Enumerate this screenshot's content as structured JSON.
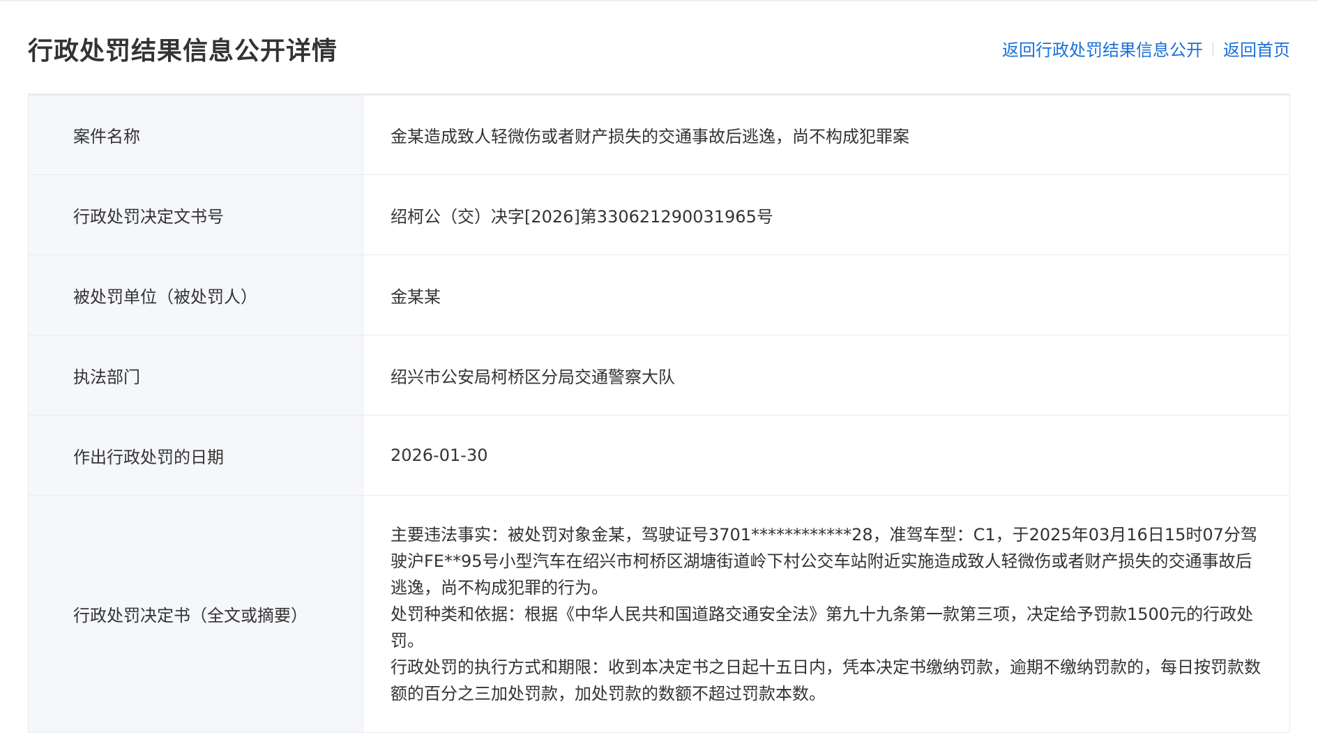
{
  "header": {
    "title": "行政处罚结果信息公开详情",
    "link_back": "返回行政处罚结果信息公开",
    "link_home": "返回首页"
  },
  "rows": [
    {
      "label": "案件名称",
      "value": "金某造成致人轻微伤或者财产损失的交通事故后逃逸，尚不构成犯罪案"
    },
    {
      "label": "行政处罚决定文书号",
      "value": "绍柯公（交）决字[2026]第330621290031965号"
    },
    {
      "label": "被处罚单位（被处罚人）",
      "value": "金某某"
    },
    {
      "label": "执法部门",
      "value": "绍兴市公安局柯桥区分局交通警察大队"
    },
    {
      "label": "作出行政处罚的日期",
      "value": "2026-01-30"
    },
    {
      "label": "行政处罚决定书（全文或摘要）",
      "paragraphs": [
        "主要违法事实：被处罚对象金某，驾驶证号3701************28，准驾车型：C1，于2025年03月16日15时07分驾驶沪FE**95号小型汽车在绍兴市柯桥区湖塘街道岭下村公交车站附近实施造成致人轻微伤或者财产损失的交通事故后逃逸，尚不构成犯罪的行为。",
        "处罚种类和依据：根据《中华人民共和国道路交通安全法》第九十九条第一款第三项，决定给予罚款1500元的行政处罚。",
        "行政处罚的执行方式和期限：收到本决定书之日起十五日内，凭本决定书缴纳罚款，逾期不缴纳罚款的，每日按罚款数额的百分之三加处罚款，加处罚款的数额不超过罚款本数。"
      ]
    }
  ]
}
